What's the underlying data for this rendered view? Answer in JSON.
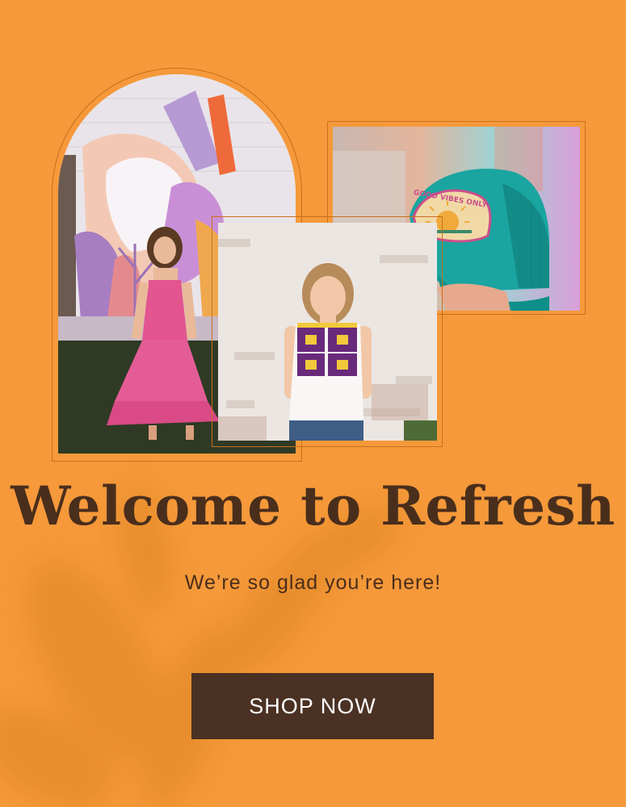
{
  "hero": {
    "headline": "Welcome to Refresh",
    "subtitle": "We’re so glad you’re here!",
    "shop_button_label": "SHOP NOW",
    "cap_patch_text": "GOOD VIBES ONLY"
  },
  "colors": {
    "background": "#f5993a",
    "text_brown": "#4a2e1c",
    "button_bg": "#4a3123",
    "button_text": "#ffffff",
    "frame_line": "#c96f1d"
  }
}
